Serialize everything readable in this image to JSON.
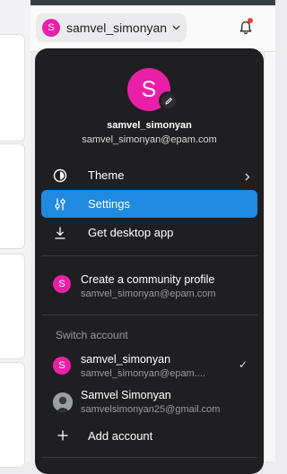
{
  "header": {
    "avatar_initial": "S",
    "username": "samvel_simonyan"
  },
  "menu": {
    "profile": {
      "initial": "S",
      "name": "samvel_simonyan",
      "email": "samvel_simonyan@epam.com"
    },
    "items": [
      {
        "label": "Theme",
        "icon": "theme-icon"
      },
      {
        "label": "Settings",
        "icon": "settings-sliders-icon"
      },
      {
        "label": "Get desktop app",
        "icon": "download-icon"
      }
    ],
    "community": {
      "initial": "S",
      "title": "Create a community profile",
      "email": "samvel_simonyan@epam.com"
    },
    "switch_label": "Switch account",
    "accounts": [
      {
        "initial": "S",
        "name": "samvel_simonyan",
        "email": "samvel_simonyan@epam....",
        "selected": true,
        "check": "✓"
      },
      {
        "name": "Samvel Simonyan",
        "email": "samvelsimonyan25@gmail.com",
        "selected": false
      }
    ],
    "add_account": "Add account"
  },
  "colors": {
    "accent": "#1f8ae0",
    "avatar": "#ea1fa7",
    "menu_bg": "#1f1f21",
    "notification": "#e8412f"
  }
}
